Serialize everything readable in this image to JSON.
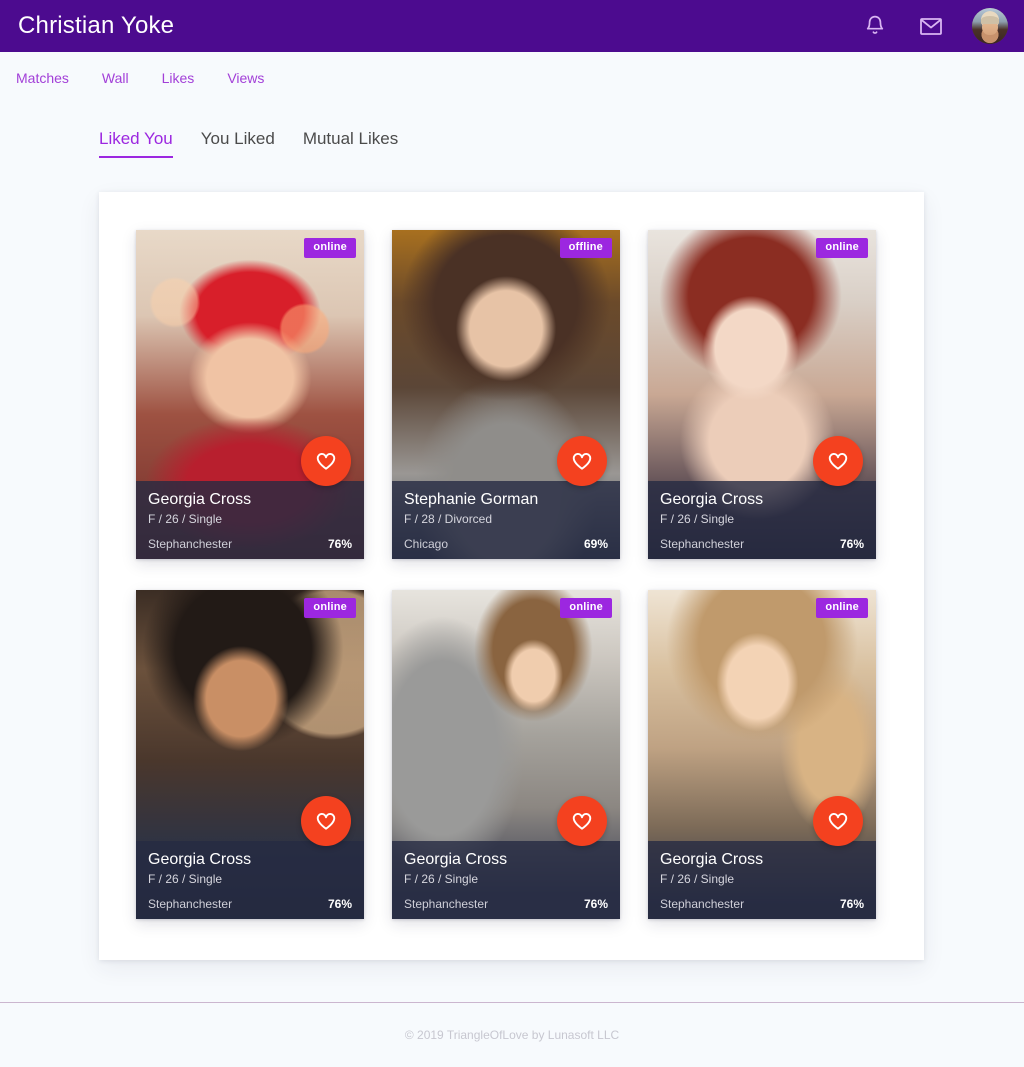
{
  "header": {
    "brand": "Christian Yoke",
    "notifications_icon": "bell-icon",
    "messages_icon": "envelope-icon",
    "avatar_icon": "user-avatar",
    "background_color": "#4c0b8f"
  },
  "nav": {
    "items": [
      {
        "label": "Matches"
      },
      {
        "label": "Wall"
      },
      {
        "label": "Likes"
      },
      {
        "label": "Views"
      }
    ],
    "link_color": "#a23fd8"
  },
  "tabs": {
    "active_index": 0,
    "accent_color": "#9c27e0",
    "items": [
      {
        "label": "Liked You"
      },
      {
        "label": "You Liked"
      },
      {
        "label": "Mutual Likes"
      }
    ]
  },
  "colors": {
    "page_background": "#f7fafd",
    "panel_background": "#ffffff",
    "badge_online": "#9c27e0",
    "like_button": "#f4411f",
    "card_overlay": "rgba(38, 42, 66, 0.80)"
  },
  "cards": [
    {
      "name": "Georgia Cross",
      "meta": "F / 26 / Single",
      "city": "Stephanchester",
      "match": "76%",
      "status": "online",
      "like_icon": "heart-icon",
      "photo": "woman-red-knit-hat-winter"
    },
    {
      "name": "Stephanie Gorman",
      "meta": "F / 28 / Divorced",
      "city": "Chicago",
      "match": "69%",
      "status": "offline",
      "like_icon": "heart-icon",
      "photo": "woman-long-brown-hair-autumn"
    },
    {
      "name": "Georgia Cross",
      "meta": "F / 26 / Single",
      "city": "Stephanchester",
      "match": "76%",
      "status": "online",
      "like_icon": "heart-icon",
      "photo": "woman-red-hair-blue-eyes"
    },
    {
      "name": "Georgia Cross",
      "meta": "F / 26 / Single",
      "city": "Stephanchester",
      "match": "76%",
      "status": "online",
      "like_icon": "heart-icon",
      "photo": "woman-dark-hair-smiling"
    },
    {
      "name": "Georgia Cross",
      "meta": "F / 26 / Single",
      "city": "Stephanchester",
      "match": "76%",
      "status": "online",
      "like_icon": "heart-icon",
      "photo": "woman-grey-sweater-leaning"
    },
    {
      "name": "Georgia Cross",
      "meta": "F / 26 / Single",
      "city": "Stephanchester",
      "match": "76%",
      "status": "online",
      "like_icon": "heart-icon",
      "photo": "woman-blonde-curly-hair"
    }
  ],
  "footer": {
    "text": "© 2019 TriangleOfLove by Lunasoft LLC"
  }
}
